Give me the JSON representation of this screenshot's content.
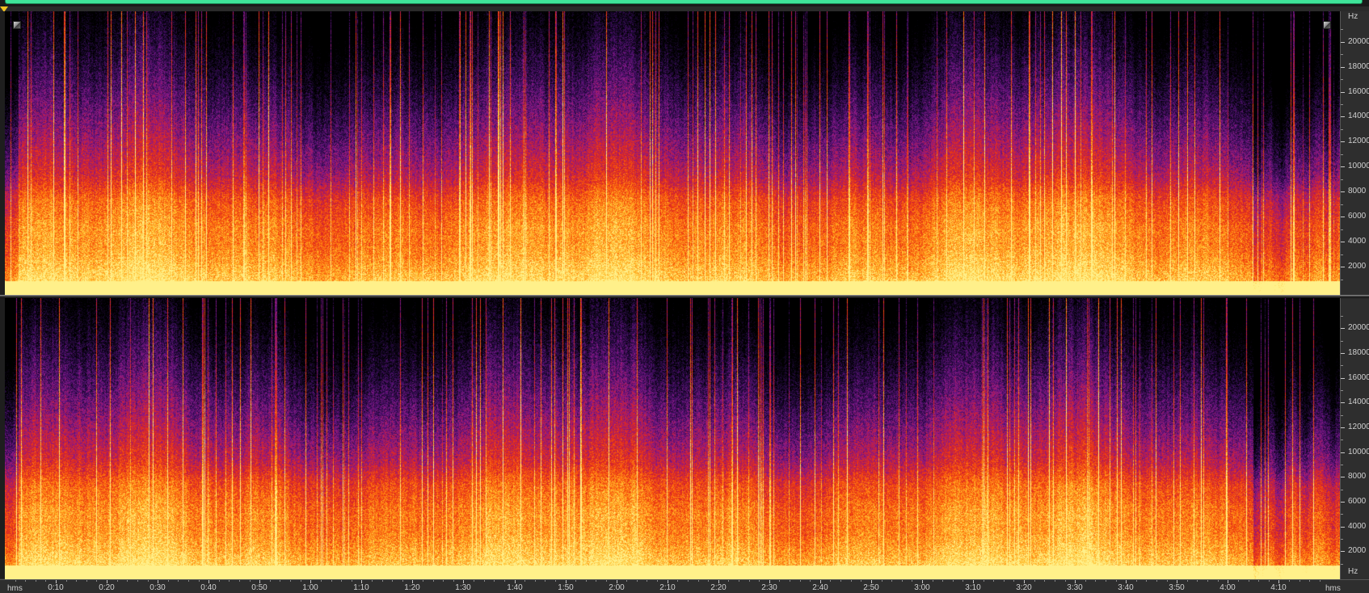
{
  "spectral_view": {
    "frequency_unit": "Hz",
    "time_unit": "hms",
    "freq_max_hz": 22050,
    "duration_seconds": 262,
    "colormap": [
      "#000000",
      "#1a0830",
      "#4a0f6a",
      "#8a1a8a",
      "#c81e3c",
      "#ee3a10",
      "#ff7a10",
      "#ffc030",
      "#fff08a"
    ],
    "channels": [
      {
        "name": "left",
        "freq_ticks": [
          {
            "value": 20000,
            "label": "20000"
          },
          {
            "value": 18000,
            "label": "18000"
          },
          {
            "value": 16000,
            "label": "16000"
          },
          {
            "value": 14000,
            "label": "14000"
          },
          {
            "value": 12000,
            "label": "12000"
          },
          {
            "value": 10000,
            "label": "10000"
          },
          {
            "value": 8000,
            "label": "8000"
          },
          {
            "value": 6000,
            "label": "6000"
          },
          {
            "value": 4000,
            "label": "4000"
          },
          {
            "value": 2000,
            "label": "2000"
          }
        ]
      },
      {
        "name": "right",
        "freq_ticks": [
          {
            "value": 20000,
            "label": "20000"
          },
          {
            "value": 18000,
            "label": "18000"
          },
          {
            "value": 16000,
            "label": "16000"
          },
          {
            "value": 14000,
            "label": "14000"
          },
          {
            "value": 12000,
            "label": "12000"
          },
          {
            "value": 10000,
            "label": "10000"
          },
          {
            "value": 8000,
            "label": "8000"
          },
          {
            "value": 6000,
            "label": "6000"
          },
          {
            "value": 4000,
            "label": "4000"
          },
          {
            "value": 2000,
            "label": "2000"
          }
        ]
      }
    ],
    "time_ticks": [
      {
        "value": 10,
        "label": "0:10"
      },
      {
        "value": 20,
        "label": "0:20"
      },
      {
        "value": 30,
        "label": "0:30"
      },
      {
        "value": 40,
        "label": "0:40"
      },
      {
        "value": 50,
        "label": "0:50"
      },
      {
        "value": 60,
        "label": "1:00"
      },
      {
        "value": 70,
        "label": "1:10"
      },
      {
        "value": 80,
        "label": "1:20"
      },
      {
        "value": 90,
        "label": "1:30"
      },
      {
        "value": 100,
        "label": "1:40"
      },
      {
        "value": 110,
        "label": "1:50"
      },
      {
        "value": 120,
        "label": "2:00"
      },
      {
        "value": 130,
        "label": "2:10"
      },
      {
        "value": 140,
        "label": "2:20"
      },
      {
        "value": 150,
        "label": "2:30"
      },
      {
        "value": 160,
        "label": "2:40"
      },
      {
        "value": 170,
        "label": "2:50"
      },
      {
        "value": 180,
        "label": "3:00"
      },
      {
        "value": 190,
        "label": "3:10"
      },
      {
        "value": 200,
        "label": "3:20"
      },
      {
        "value": 210,
        "label": "3:30"
      },
      {
        "value": 220,
        "label": "3:40"
      },
      {
        "value": 230,
        "label": "3:50"
      },
      {
        "value": 240,
        "label": "4:00"
      },
      {
        "value": 250,
        "label": "4:10"
      }
    ]
  }
}
